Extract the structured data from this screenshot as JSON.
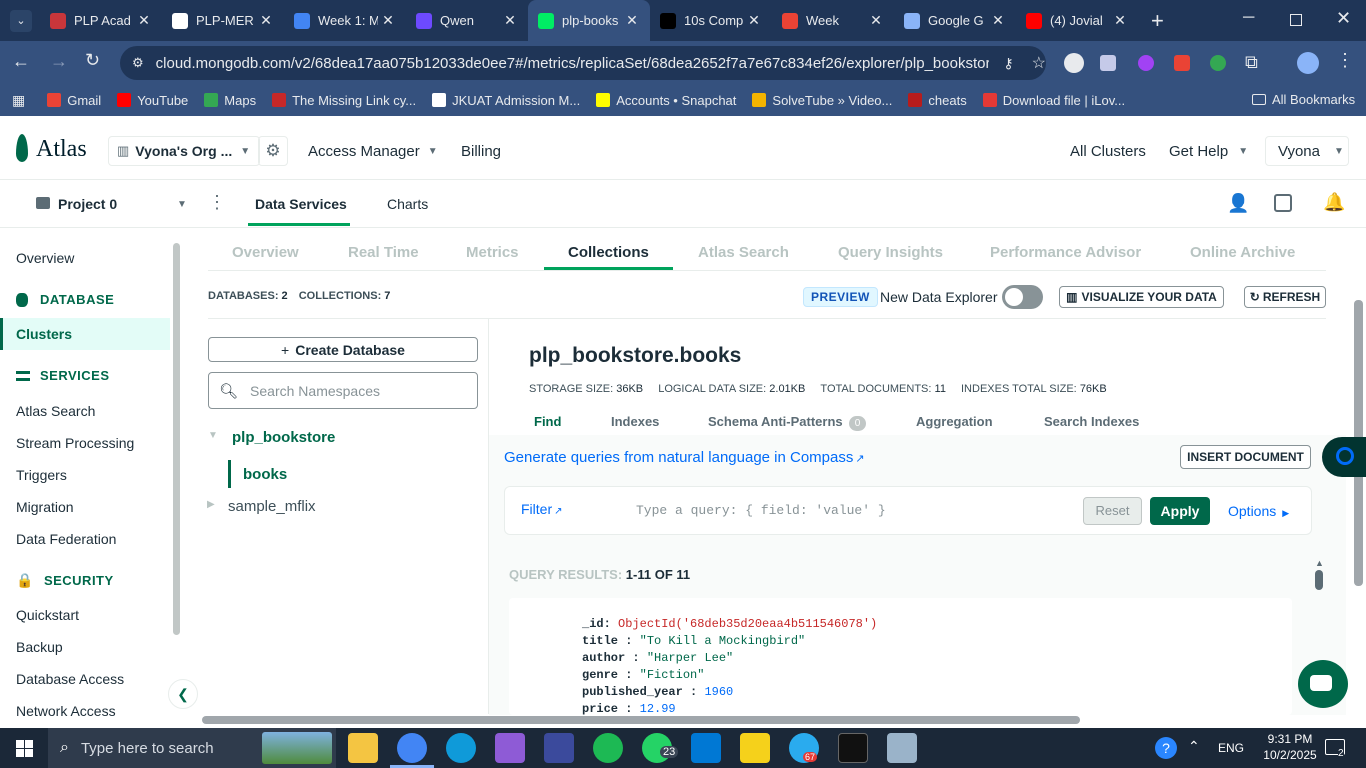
{
  "browser": {
    "tabs": [
      {
        "title": "PLP Acad",
        "color": "#c8363b"
      },
      {
        "title": "PLP-MER",
        "color": "#ffffff"
      },
      {
        "title": "Week 1: M",
        "color": "#4285f4"
      },
      {
        "title": "Qwen",
        "color": "#6d4aff"
      },
      {
        "title": "plp-books",
        "color": "#00ed64"
      },
      {
        "title": "10s Comp",
        "color": "#000000"
      },
      {
        "title": "Week",
        "color": "#ea4335"
      },
      {
        "title": "Google G",
        "color": "#8ab4f8"
      },
      {
        "title": "(4) Jovial",
        "color": "#ff0000"
      }
    ],
    "url": "cloud.mongodb.com/v2/68dea17aa075b12033de0ee7#/metrics/replicaSet/68dea2652f7a7e67c834ef26/explorer/plp_bookstore/b...",
    "bookmarks": [
      {
        "label": "Gmail",
        "color": "#ea4335"
      },
      {
        "label": "YouTube",
        "color": "#ff0000"
      },
      {
        "label": "Maps",
        "color": "#34a853"
      },
      {
        "label": "The Missing Link cy...",
        "color": "#c62828"
      },
      {
        "label": "JKUAT Admission M...",
        "color": "#ffffff"
      },
      {
        "label": "Accounts • Snapchat",
        "color": "#fffc00"
      },
      {
        "label": "SolveTube » Video...",
        "color": "#f4b400"
      },
      {
        "label": "cheats",
        "color": "#b71c1c"
      },
      {
        "label": "Download file | iLov...",
        "color": "#e53935"
      }
    ],
    "all_bookmarks": "All Bookmarks"
  },
  "atlas": {
    "logo": "Atlas",
    "org": "Vyona's Org ...",
    "nav": [
      "Access Manager",
      "Billing"
    ],
    "right_nav": [
      "All Clusters",
      "Get Help",
      "Vyona"
    ],
    "project": "Project 0",
    "subnav": [
      "Data Services",
      "Charts"
    ]
  },
  "sidebar": {
    "overview": "Overview",
    "database_header": "DATABASE",
    "clusters": "Clusters",
    "services_header": "SERVICES",
    "services": [
      "Atlas Search",
      "Stream Processing",
      "Triggers",
      "Migration",
      "Data Federation"
    ],
    "security_header": "SECURITY",
    "security": [
      "Quickstart",
      "Backup",
      "Database Access",
      "Network Access"
    ]
  },
  "main_tabs": [
    "Overview",
    "Real Time",
    "Metrics",
    "Collections",
    "Atlas Search",
    "Query Insights",
    "Performance Advisor",
    "Online Archive"
  ],
  "stats": {
    "databases_label": "DATABASES:",
    "databases": "2",
    "collections_label": "COLLECTIONS:",
    "collections": "7"
  },
  "toolbar": {
    "preview": "PREVIEW",
    "new_explorer": "New Data Explorer",
    "visualize": "VISUALIZE YOUR DATA",
    "refresh": "REFRESH"
  },
  "namespaces": {
    "create_db": "Create Database",
    "search_placeholder": "Search Namespaces",
    "db1": "plp_bookstore",
    "coll1": "books",
    "db2": "sample_mflix"
  },
  "collection": {
    "title": "plp_bookstore.books",
    "storage_size_label": "STORAGE SIZE:",
    "storage_size": "36KB",
    "logical_size_label": "LOGICAL DATA SIZE:",
    "logical_size": "2.01KB",
    "total_docs_label": "TOTAL DOCUMENTS:",
    "total_docs": "11",
    "indexes_size_label": "INDEXES TOTAL SIZE:",
    "indexes_size": "76KB",
    "tabs": [
      "Find",
      "Indexes",
      "Schema Anti-Patterns",
      "Aggregation",
      "Search Indexes"
    ],
    "schema_count": "0",
    "compass_link": "Generate queries from natural language in Compass",
    "insert_doc": "INSERT DOCUMENT",
    "filter": "Filter",
    "query_placeholder": "Type a query: { field: 'value' }",
    "reset": "Reset",
    "apply": "Apply",
    "options": "Options",
    "results_label": "QUERY RESULTS:",
    "results_range": "1-11 OF 11"
  },
  "document": {
    "id_key": "_id",
    "id_val": "ObjectId('68deb35d20eaa4b511546078')",
    "title_key": "title",
    "title_val": "\"To Kill a Mockingbird\"",
    "author_key": "author",
    "author_val": "\"Harper Lee\"",
    "genre_key": "genre",
    "genre_val": "\"Fiction\"",
    "year_key": "published_year",
    "year_val": "1960",
    "price_key": "price",
    "price_val": "12.99"
  },
  "taskbar": {
    "search_placeholder": "Type here to search",
    "whatsapp_badge": "23",
    "telegram_badge": "67",
    "lang": "ENG",
    "time": "9:31 PM",
    "date": "10/2/2025",
    "notif_count": "2"
  },
  "colors": {
    "accent": "#00684a",
    "link": "#016bf8",
    "brand": "#00ed64"
  }
}
